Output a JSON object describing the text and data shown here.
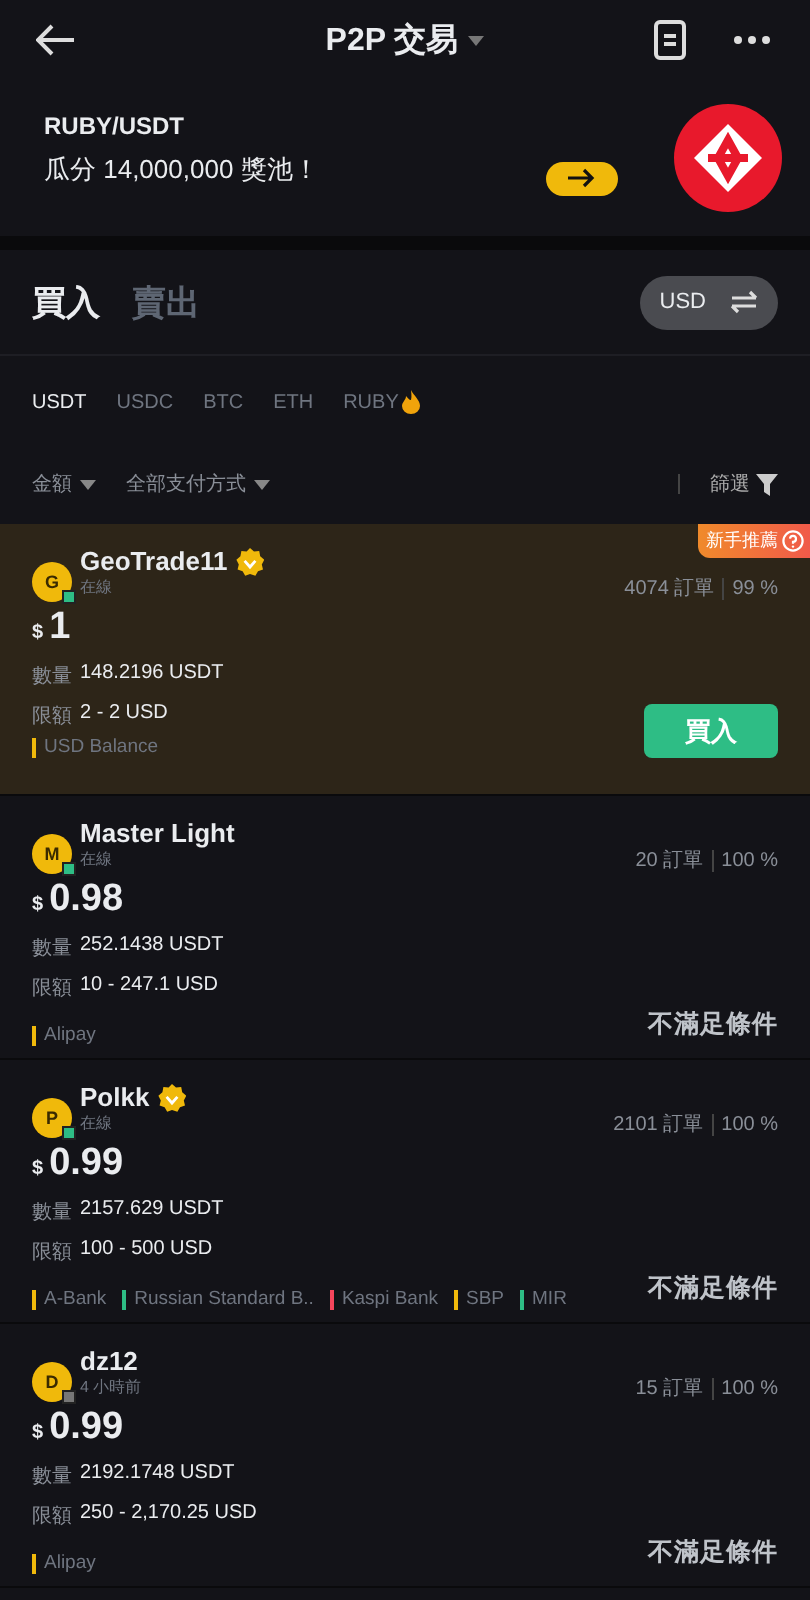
{
  "header": {
    "title": "P2P 交易"
  },
  "banner": {
    "title": "RUBY/USDT",
    "subtitle": "瓜分 14,000,000 獎池！"
  },
  "trade_tabs": [
    {
      "label": "買入",
      "selected": true
    },
    {
      "label": "賣出",
      "selected": false
    }
  ],
  "currency": "USD",
  "coins": [
    {
      "label": "USDT",
      "selected": true,
      "hot": false
    },
    {
      "label": "USDC",
      "selected": false,
      "hot": false
    },
    {
      "label": "BTC",
      "selected": false,
      "hot": false
    },
    {
      "label": "ETH",
      "selected": false,
      "hot": false
    },
    {
      "label": "RUBY",
      "selected": false,
      "hot": true
    }
  ],
  "filters": {
    "amount": "金額",
    "payment": "全部支付方式",
    "filter": "篩選"
  },
  "offers": [
    {
      "featured": true,
      "badge": "新手推薦",
      "avatar": "G",
      "name": "GeoTrade11",
      "verified": true,
      "status": "在線",
      "online": true,
      "orders": "4074 訂單",
      "completion": "99 %",
      "symbol": "$",
      "price": "1",
      "amount_label": "數量",
      "amount": "148.2196 USDT",
      "limit_label": "限額",
      "limit": "2 - 2 USD",
      "payments": [
        {
          "name": "USD Balance",
          "color": "#f0b90b"
        }
      ],
      "action": {
        "kind": "button",
        "label": "買入"
      }
    },
    {
      "featured": false,
      "avatar": "M",
      "name": "Master Light",
      "verified": false,
      "status": "在線",
      "online": true,
      "orders": "20 訂單",
      "completion": "100 %",
      "symbol": "$",
      "price": "0.98",
      "amount_label": "數量",
      "amount": "252.1438 USDT",
      "limit_label": "限額",
      "limit": "10 - 247.1 USD",
      "payments": [
        {
          "name": "Alipay",
          "color": "#f0b90b"
        }
      ],
      "action": {
        "kind": "note",
        "label": "不滿足條件"
      }
    },
    {
      "featured": false,
      "avatar": "P",
      "name": "Polkk",
      "verified": true,
      "status": "在線",
      "online": true,
      "orders": "2101 訂單",
      "completion": "100 %",
      "symbol": "$",
      "price": "0.99",
      "amount_label": "數量",
      "amount": "2157.629 USDT",
      "limit_label": "限額",
      "limit": "100 - 500 USD",
      "payments": [
        {
          "name": "A-Bank",
          "color": "#f0b90b"
        },
        {
          "name": "Russian Standard B..",
          "color": "#2ebd85"
        },
        {
          "name": "Kaspi Bank",
          "color": "#f6465d"
        },
        {
          "name": "SBP",
          "color": "#f0b90b"
        },
        {
          "name": "MIR",
          "color": "#2ebd85"
        }
      ],
      "action": {
        "kind": "note",
        "label": "不滿足條件"
      }
    },
    {
      "featured": false,
      "avatar": "D",
      "name": "dz12",
      "verified": false,
      "status": "4 小時前",
      "online": false,
      "orders": "15 訂單",
      "completion": "100 %",
      "symbol": "$",
      "price": "0.99",
      "amount_label": "數量",
      "amount": "2192.1748 USDT",
      "limit_label": "限額",
      "limit": "250 - 2,170.25 USD",
      "payments": [
        {
          "name": "Alipay",
          "color": "#f0b90b"
        }
      ],
      "action": {
        "kind": "note",
        "label": "不滿足條件"
      }
    }
  ]
}
